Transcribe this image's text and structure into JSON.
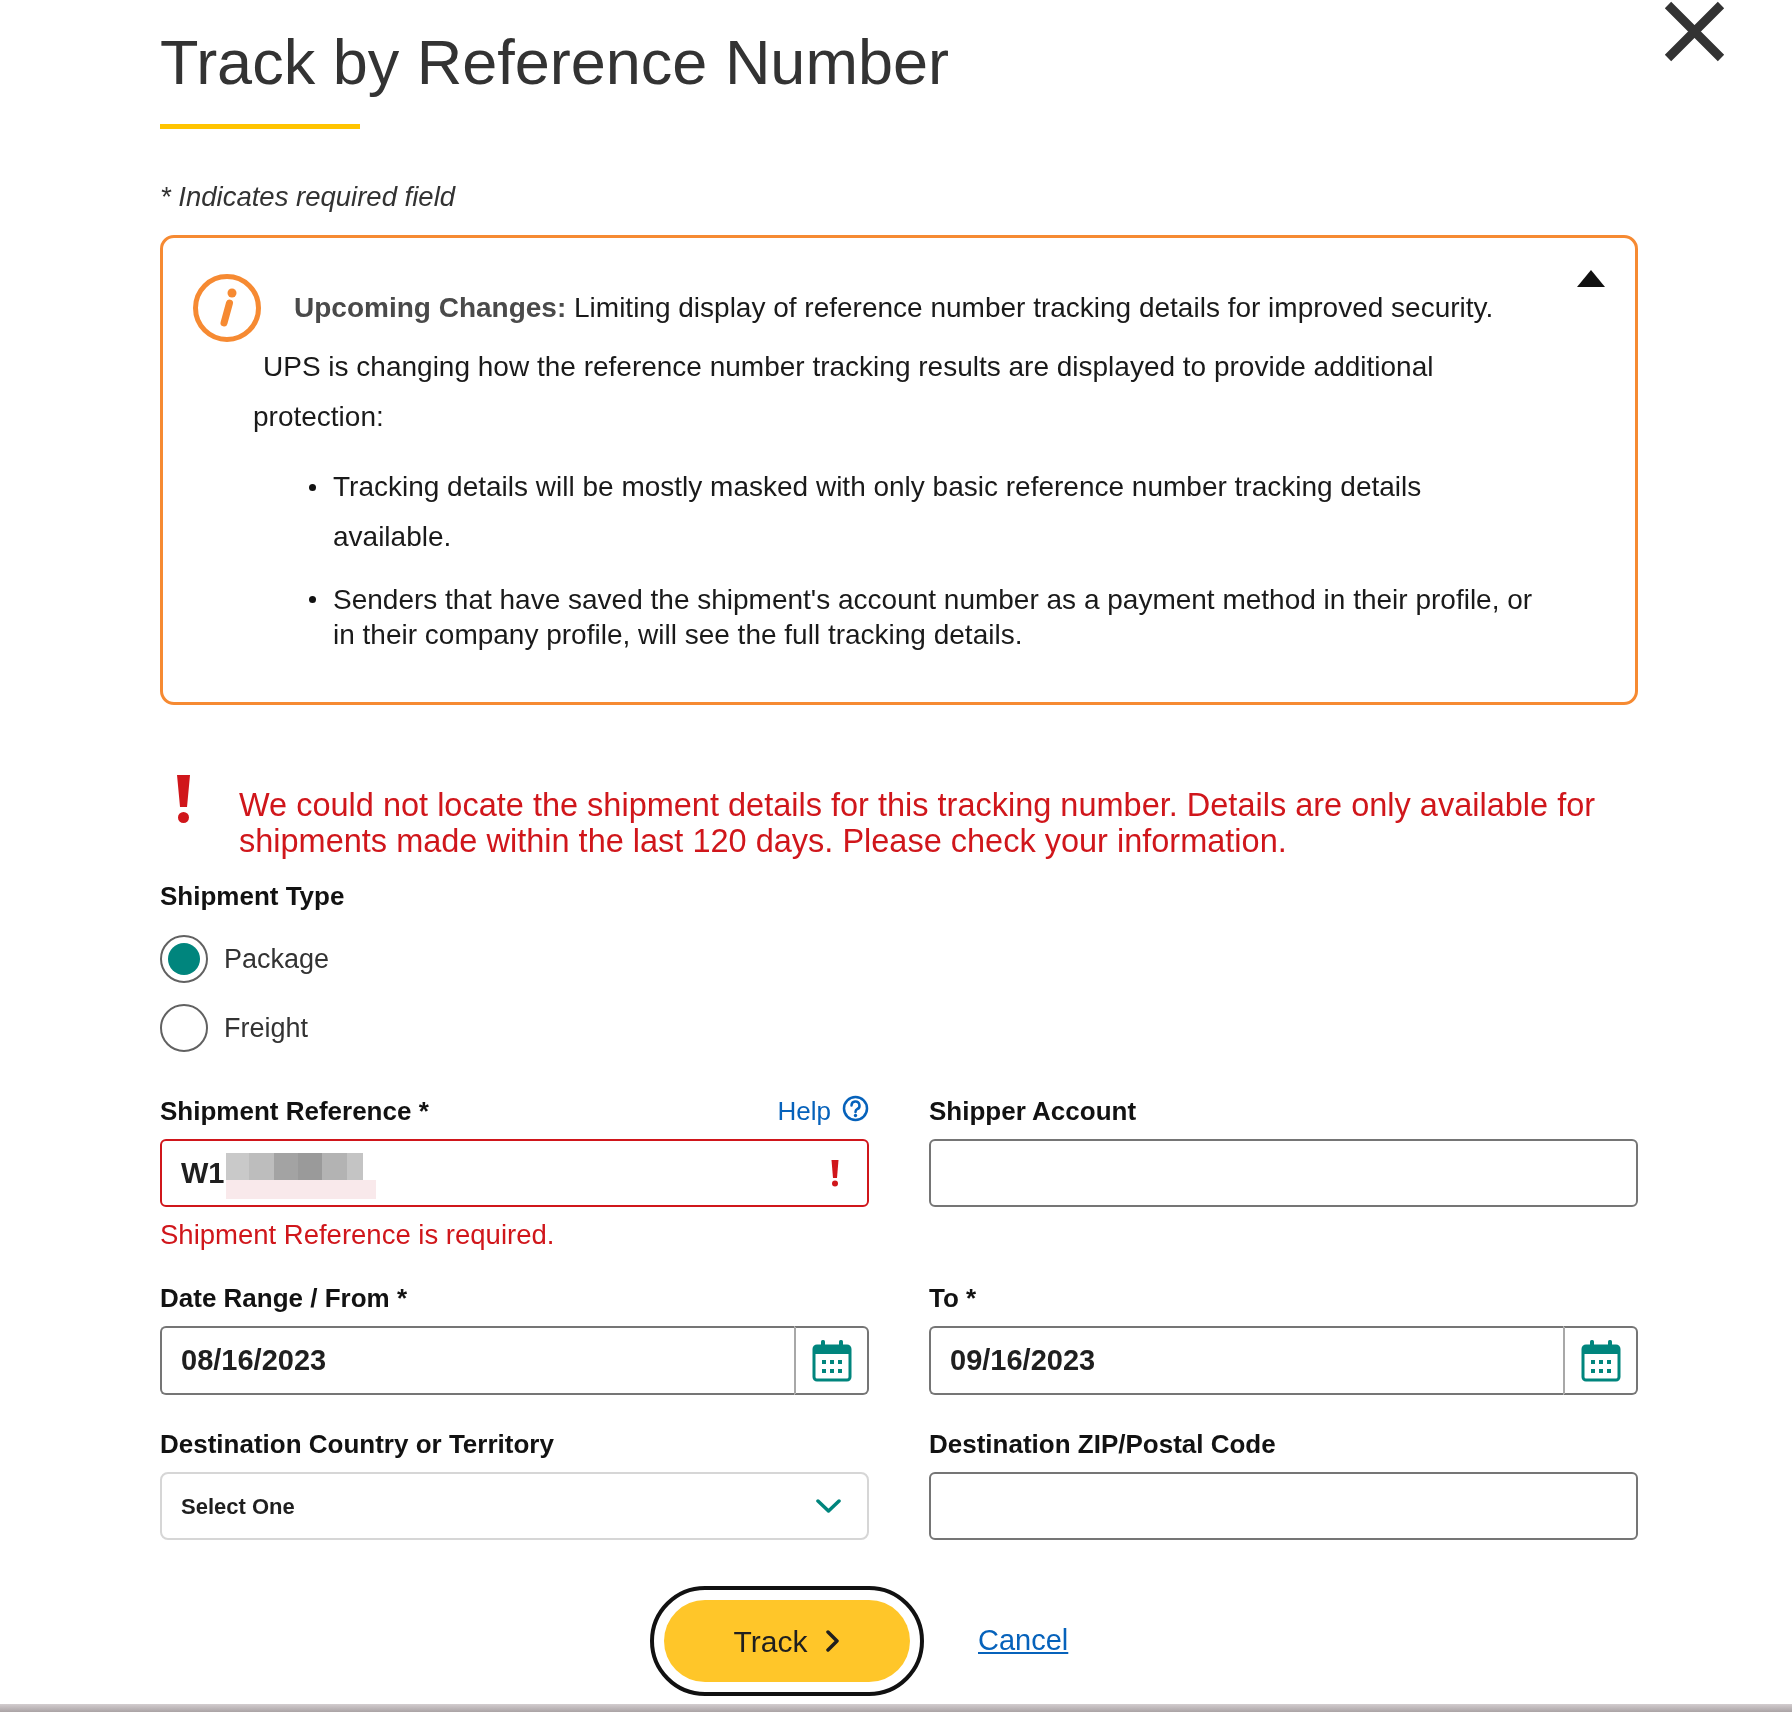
{
  "dialog": {
    "title": "Track by Reference Number",
    "required_note": "* Indicates required field"
  },
  "notice": {
    "expanded": true,
    "summary": "**Upcoming Changes:** Limiting display of reference number tracking details for improved security.",
    "paragraph": "UPS is changing how the reference number tracking results are displayed to provide additional protection:",
    "bullets": [
      "Tracking details will be mostly masked with only basic reference number tracking details available.",
      "Senders that have saved the shipment's account number as a payment method in their profile, or in their company profile, will see the full tracking details."
    ]
  },
  "error_message": "We could not locate the shipment details for this tracking number. Details are only available for shipments made within the last 120 days. Please check your information.",
  "shipment_type": {
    "label": "Shipment Type",
    "options": [
      {
        "label": "Package",
        "selected": true
      },
      {
        "label": "Freight",
        "selected": false
      }
    ]
  },
  "fields": [
    {
      "kind": "text",
      "label": "Shipment Reference *",
      "help": "Help",
      "value": "W1",
      "redacted": true,
      "invalid": true,
      "error": "Shipment Reference is required."
    },
    {
      "kind": "text",
      "label": "Shipper Account",
      "invalid": false
    },
    {
      "kind": "date",
      "label": "Date Range / From *",
      "value": "08/16/2023"
    },
    {
      "kind": "date",
      "label": "To *",
      "value": "09/16/2023"
    },
    {
      "kind": "select",
      "label": "Destination Country or Territory",
      "value": "Select One"
    },
    {
      "kind": "text",
      "label": "Destination ZIP/Postal Code",
      "invalid": false
    }
  ],
  "actions": {
    "track": "Track",
    "cancel": "Cancel"
  }
}
